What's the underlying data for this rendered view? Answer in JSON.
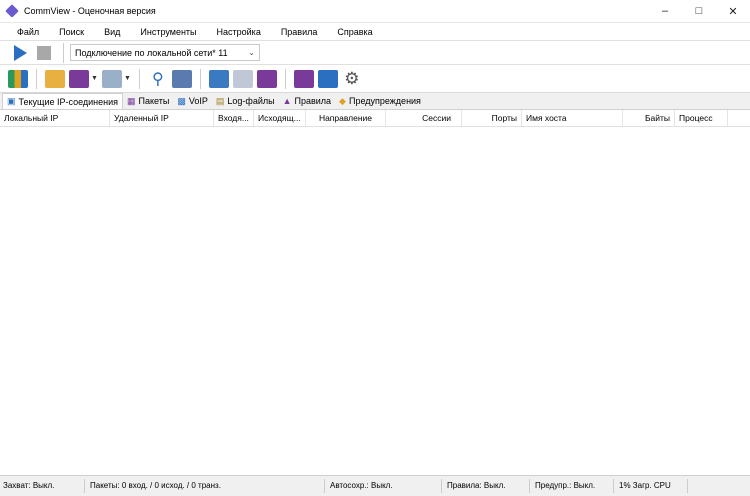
{
  "window": {
    "title": "CommView - Оценочная версия"
  },
  "menu": [
    "Файл",
    "Поиск",
    "Вид",
    "Инструменты",
    "Настройка",
    "Правила",
    "Справка"
  ],
  "toolbar": {
    "adapter": "Подключение по локальной сети* 11"
  },
  "tabs": [
    "Текущие IP-соединения",
    "Пакеты",
    "VoIP",
    "Log-файлы",
    "Правила",
    "Предупреждения"
  ],
  "columns": [
    "Локальный IP",
    "Удаленный IP",
    "Входя...",
    "Исходящ...",
    "Направление",
    "Сессии",
    "Порты",
    "Имя хоста",
    "Байты",
    "Процесс"
  ],
  "status": [
    "Захват: Выкл.",
    "Пакеты: 0 вход. / 0 исход. / 0 транз.",
    "Автосохр.: Выкл.",
    "Правила: Выкл.",
    "Предупр.: Выкл.",
    "1% Загр. CPU"
  ]
}
